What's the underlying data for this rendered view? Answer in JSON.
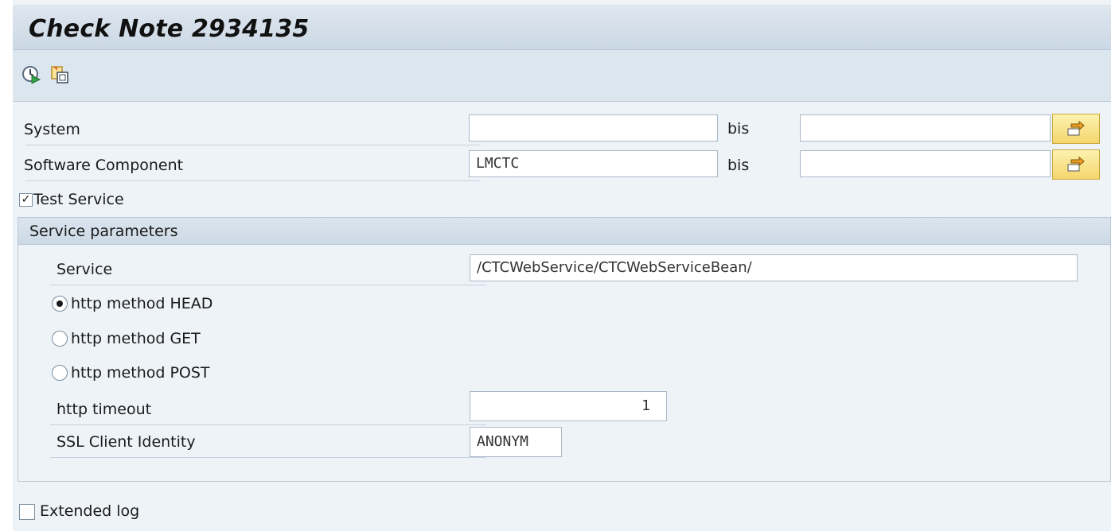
{
  "title": "Check Note 2934135",
  "toolbar": {
    "execute_icon": "execute-clock-icon",
    "copy_icon": "copy-variant-icon"
  },
  "selection": {
    "system": {
      "label": "System",
      "from": "",
      "bis": "bis",
      "to": ""
    },
    "software_component": {
      "label": "Software Component",
      "from": "LMCTC",
      "bis": "bis",
      "to": ""
    }
  },
  "test_service": {
    "label": "Test Service",
    "checked": true
  },
  "service_params": {
    "header": "Service parameters",
    "service_label": "Service",
    "service_value": "/CTCWebService/CTCWebServiceBean/",
    "methods": [
      {
        "label": "http method HEAD",
        "selected": true
      },
      {
        "label": "http method GET",
        "selected": false
      },
      {
        "label": "http method POST",
        "selected": false
      }
    ],
    "timeout_label": "http timeout",
    "timeout_value": "1",
    "ssl_label": "SSL Client Identity",
    "ssl_value": "ANONYM"
  },
  "extended_log": {
    "label": "Extended log",
    "checked": false
  },
  "colors": {
    "accent_button": "#f4d66c",
    "frame_bg": "#eef3f8",
    "title_bg": "#cbd8e5"
  }
}
